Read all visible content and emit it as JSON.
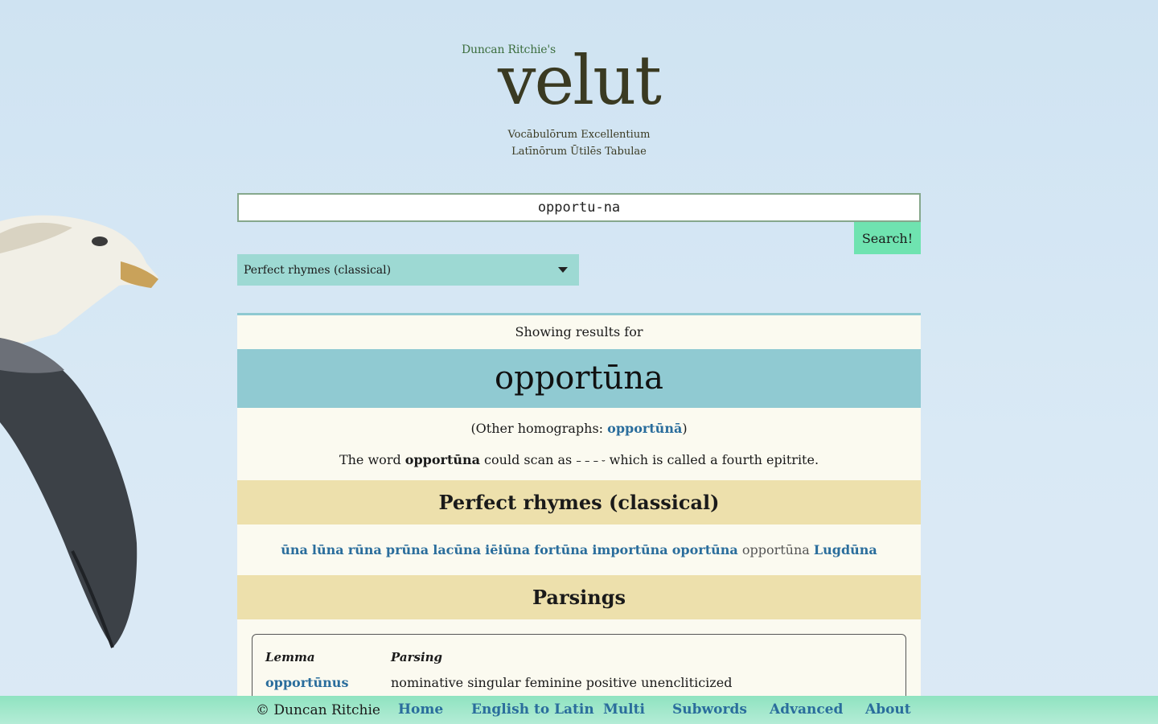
{
  "header": {
    "byline": "Duncan Ritchie's",
    "logo": "velut",
    "tagline_line1": "Vocābulōrum Excellentium",
    "tagline_line2": "Latīnōrum Ūtilēs Tabulae"
  },
  "search": {
    "value": "opportu-na",
    "button_label": "Search!",
    "mode_selected": "Perfect rhymes (classical)"
  },
  "results": {
    "showing_label": "Showing results for",
    "word": "opportūna",
    "homographs_prefix": "(Other homographs: ",
    "homograph_link": "opportūnā",
    "homographs_suffix": ")",
    "scan_prefix": "The word ",
    "scan_word": "opportūna",
    "scan_middle": " could scan as ",
    "scansion": "– – – ⏑",
    "scan_suffix": " which is called a fourth epitrite.",
    "rhymes_heading": "Perfect rhymes (classical)",
    "rhymes": [
      {
        "text": "ūna",
        "link": true
      },
      {
        "text": "lūna",
        "link": true
      },
      {
        "text": "rūna",
        "link": true
      },
      {
        "text": "prūna",
        "link": true
      },
      {
        "text": "lacūna",
        "link": true
      },
      {
        "text": "iēiūna",
        "link": true
      },
      {
        "text": "fortūna",
        "link": true
      },
      {
        "text": "importūna",
        "link": true
      },
      {
        "text": "oportūna",
        "link": true
      },
      {
        "text": "opportūna",
        "link": false
      },
      {
        "text": "Lugdūna",
        "link": true
      }
    ],
    "parsings_heading": "Parsings",
    "parse_table": {
      "col_lemma": "Lemma",
      "col_parsing": "Parsing",
      "rows": [
        {
          "lemma": "opportūnus",
          "parsing": "nominative singular feminine positive unencliticized"
        }
      ]
    }
  },
  "footer": {
    "copyright": "© Duncan Ritchie",
    "nav": [
      "Home",
      "English to Latin",
      "Multi",
      "Subwords",
      "Advanced",
      "About"
    ]
  },
  "colors": {
    "accent_green": "#6fe3b0",
    "select_teal": "#9dd9d3",
    "word_band": "#90cad2",
    "section_band": "#ede0ac",
    "link_blue": "#2a6d9c"
  }
}
